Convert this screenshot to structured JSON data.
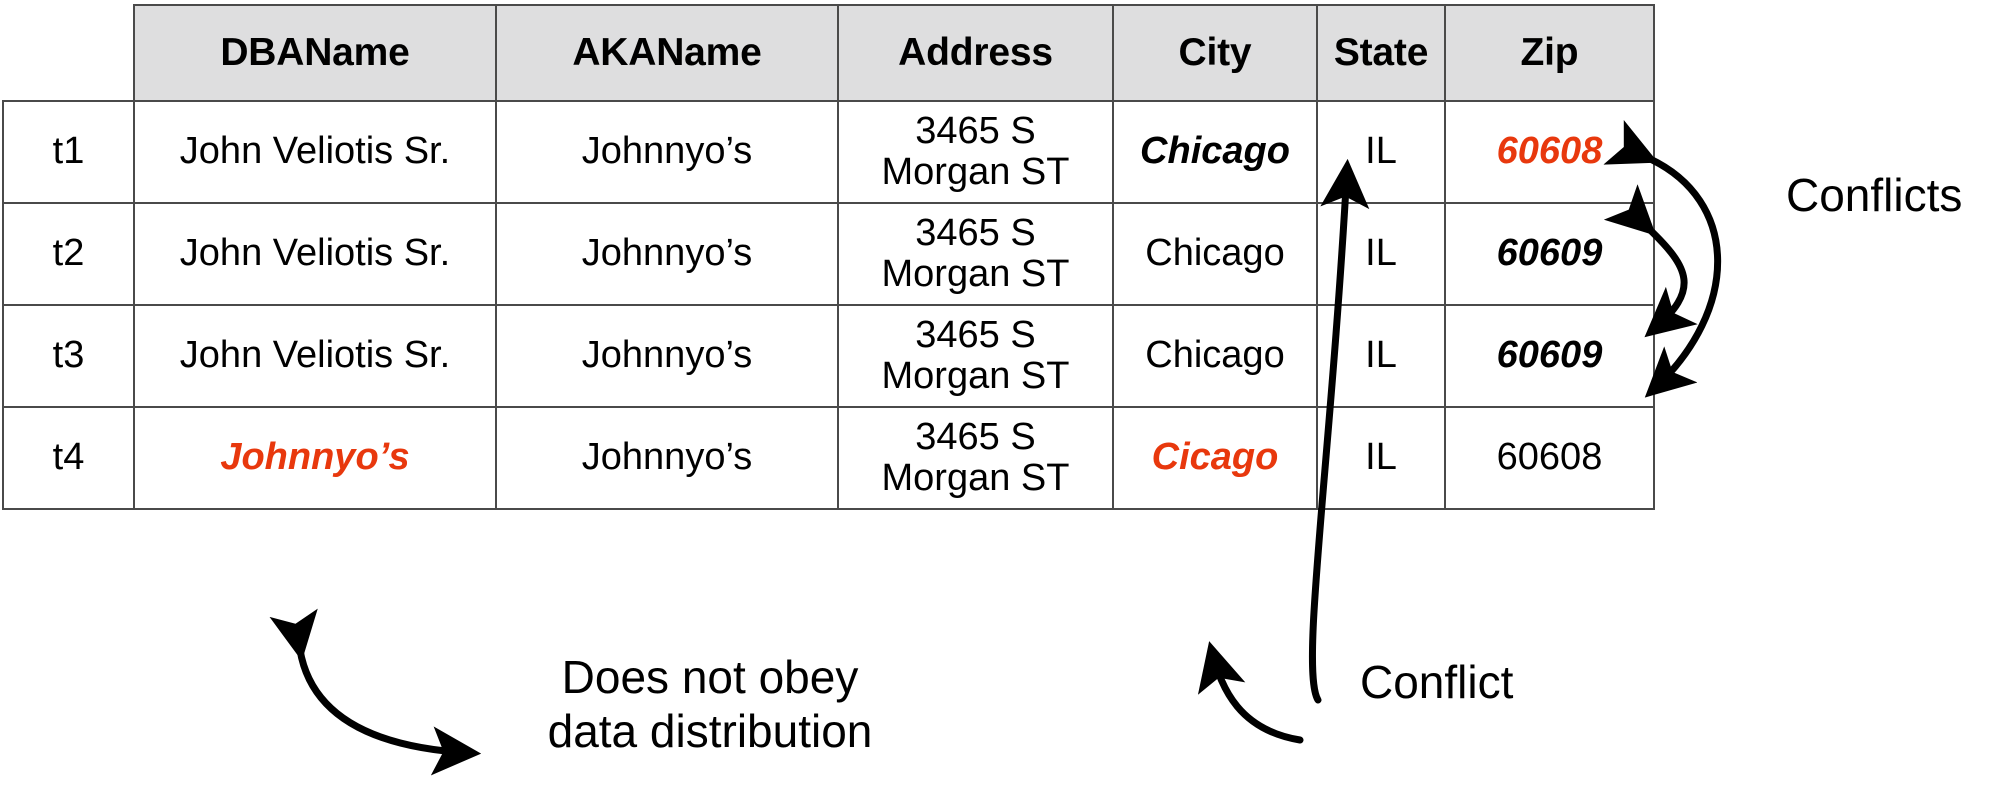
{
  "figure": {
    "title": "Conflicting tuples table",
    "accent_red": "#e8380d",
    "header_fill": "#dededf",
    "border_color": "#4a4a4a"
  },
  "table": {
    "corner_label": "",
    "columns": [
      "DBAName",
      "AKAName",
      "Address",
      "City",
      "State",
      "Zip"
    ],
    "rows": [
      {
        "id": "t1",
        "dbaname": "John Veliotis Sr.",
        "akaname": "Johnnyo’s",
        "address_line1": "3465 S",
        "address_line2": "Morgan ST",
        "city": "Chicago",
        "state": "IL",
        "zip": "60608"
      },
      {
        "id": "t2",
        "dbaname": "John Veliotis Sr.",
        "akaname": "Johnnyo’s",
        "address_line1": "3465 S",
        "address_line2": "Morgan ST",
        "city": "Chicago",
        "state": "IL",
        "zip": "60609"
      },
      {
        "id": "t3",
        "dbaname": "John Veliotis Sr.",
        "akaname": "Johnnyo’s",
        "address_line1": "3465 S",
        "address_line2": "Morgan ST",
        "city": "Chicago",
        "state": "IL",
        "zip": "60609"
      },
      {
        "id": "t4",
        "dbaname": "Johnnyo’s",
        "akaname": "Johnnyo’s",
        "address_line1": "3465 S",
        "address_line2": "Morgan ST",
        "city": "Cicago",
        "state": "IL",
        "zip": "60608"
      }
    ]
  },
  "annotations": {
    "conflicts": "Conflicts",
    "conflict": "Conflict",
    "does_not_obey_line1": "Does not obey",
    "does_not_obey_line2": "data distribution"
  }
}
